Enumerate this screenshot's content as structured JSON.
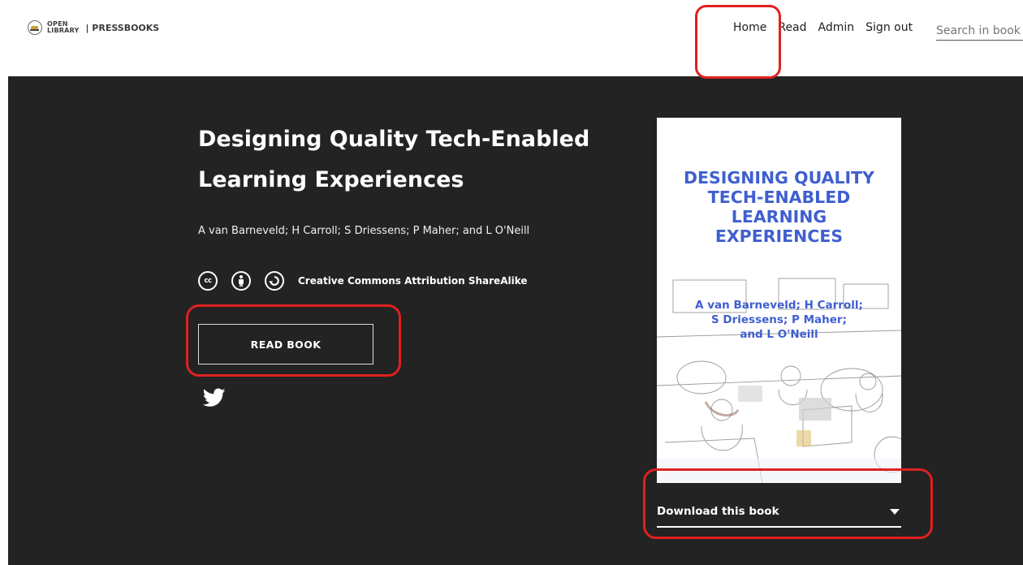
{
  "logo": {
    "line1": "OPEN",
    "line2": "LIBRARY",
    "separator": "| PRESSBOOKS"
  },
  "nav": {
    "items": [
      {
        "label": "Home"
      },
      {
        "label": "Read"
      },
      {
        "label": "Admin"
      },
      {
        "label": "Sign out"
      }
    ],
    "search_placeholder": "Search in book"
  },
  "book": {
    "title": "Designing Quality Tech-Enabled Learning Experiences",
    "authors": "A van Barneveld; H Carroll; S Driessens; P Maher; and L O'Neill",
    "license_text": "Creative Commons Attribution ShareAlike",
    "read_button": "READ BOOK",
    "download_label": "Download this book"
  },
  "cover": {
    "title_lines": [
      "DESIGNING QUALITY",
      "TECH-ENABLED",
      "LEARNING",
      "EXPERIENCES"
    ],
    "author_lines": [
      "A van Barneveld; H Carroll;",
      "S Driessens; P Maher;",
      "and L O'Neill"
    ]
  },
  "colors": {
    "hero_bg": "#232323",
    "cover_title": "#3f5fd0",
    "annotation": "#e02020"
  }
}
